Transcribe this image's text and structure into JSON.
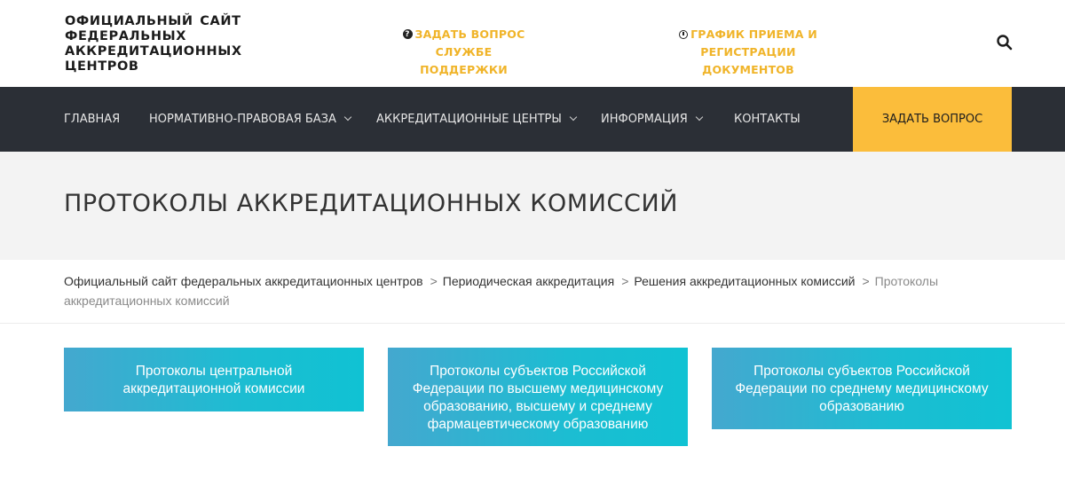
{
  "header": {
    "logo_text": "ОФИЦИАЛЬНЫЙ САЙТ ФЕДЕРАЛЬНЫХ АККРЕДИТАЦИОННЫХ ЦЕНТРОВ",
    "support_link": {
      "icon": "question-circle-icon",
      "line1": "ЗАДАТЬ ВОПРОС",
      "line2": "СЛУЖБЕ ПОДДЕРЖКИ"
    },
    "schedule_link": {
      "icon": "clock-icon",
      "line1": "ГРАФИК ПРИЕМА И РЕГИСТРАЦИИ",
      "line2": "ДОКУМЕНТОВ"
    },
    "search_icon": "search-icon",
    "accent_color": "#f0b429"
  },
  "nav": {
    "items": [
      {
        "label": "ГЛАВНАЯ",
        "has_dropdown": false
      },
      {
        "label": "НОРМАТИВНО-ПРАВОВАЯ БАЗА",
        "has_dropdown": true
      },
      {
        "label": "АККРЕДИТАЦИОННЫЕ ЦЕНТРЫ",
        "has_dropdown": true
      },
      {
        "label": "ИНФОРМАЦИЯ",
        "has_dropdown": true
      },
      {
        "label": "КОНТАКТЫ",
        "has_dropdown": false
      }
    ],
    "cta_label": "ЗАДАТЬ ВОПРОС",
    "background_color": "#2b2f36",
    "cta_color": "#fbbd3b"
  },
  "page": {
    "title": "ПРОТОКОЛЫ АККРЕДИТАЦИОННЫХ КОМИССИЙ"
  },
  "breadcrumb": {
    "items": [
      "Официальный сайт федеральных аккредитационных центров",
      "Периодическая аккредитация",
      "Решения аккредитационных комиссий"
    ],
    "separator": ">",
    "current": "Протоколы аккредитационных комиссий"
  },
  "cards": [
    {
      "label": "Протоколы центральной аккредитационной комиссии"
    },
    {
      "label": "Протоколы субъектов Российской Федерации по высшему медицинскому образованию, высшему и среднему фармацевтическому образованию"
    },
    {
      "label": "Протоколы субъектов Российской Федерации по среднему медицинскому образованию"
    }
  ]
}
